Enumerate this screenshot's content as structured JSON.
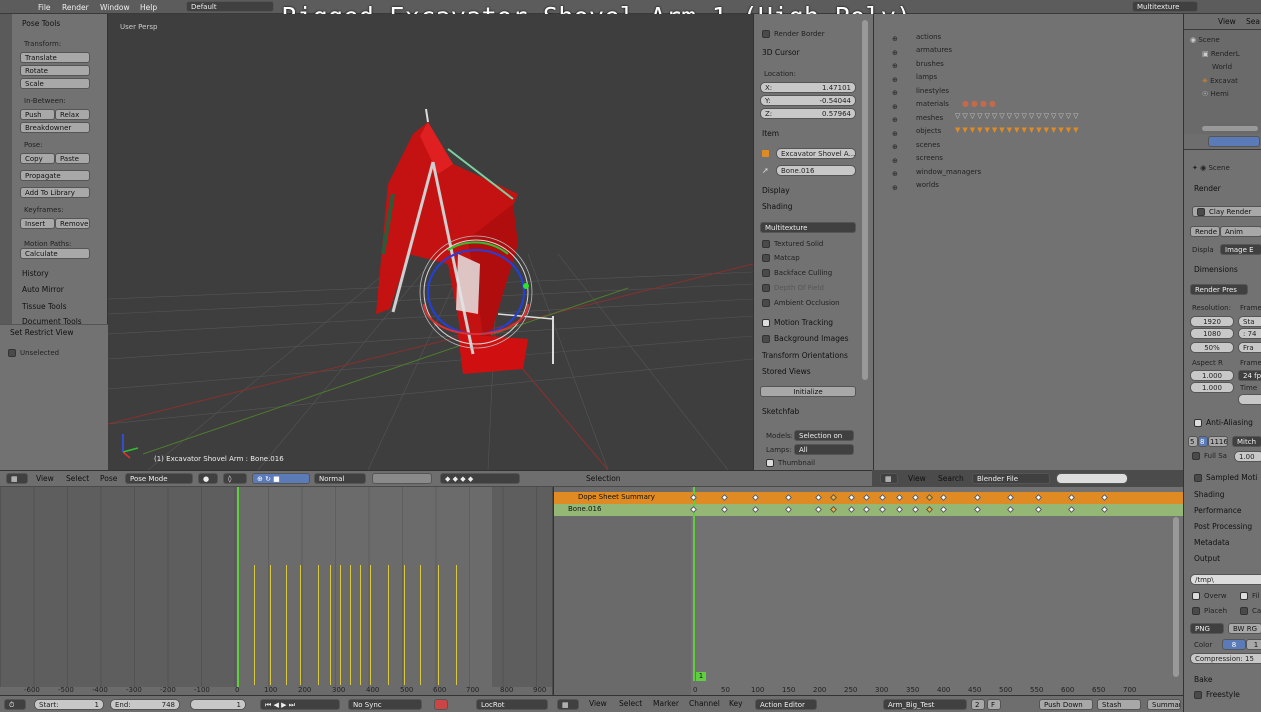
{
  "overlay_title": "Rigged Excavator Shovel Arm 1 (High Poly)",
  "top_menu": {
    "file": "File",
    "render": "Render",
    "window": "Window",
    "help": "Help",
    "layout": "Default",
    "engine_partial": "Multitexture"
  },
  "tool_shelf": {
    "header": "Pose Tools",
    "vertical_tabs": [
      "Tools",
      "Options",
      "Grease Pencil",
      "Display",
      "Animation",
      "Paper Model"
    ],
    "transform_label": "Transform:",
    "translate": "Translate",
    "rotate": "Rotate",
    "scale": "Scale",
    "inbetween_label": "In-Between:",
    "push": "Push",
    "relax": "Relax",
    "breakdowner": "Breakdowner",
    "pose_label": "Pose:",
    "copy": "Copy",
    "paste": "Paste",
    "propagate": "Propagate",
    "add_to_library": "Add To Library",
    "keyframes_label": "Keyframes:",
    "insert": "Insert",
    "remove": "Remove",
    "motion_paths_label": "Motion Paths:",
    "calculate": "Calculate",
    "history": "History",
    "auto_mirror": "Auto Mirror",
    "tissue_tools": "Tissue Tools",
    "document_tools": "Document Tools",
    "restrict_header": "Set Restrict View",
    "unselected": "Unselected"
  },
  "viewport": {
    "view_name": "User Persp",
    "status": "(1) Excavator Shovel Arm : Bone.016"
  },
  "viewport_header": {
    "view": "View",
    "select": "Select",
    "pose": "Pose",
    "mode": "Pose Mode",
    "orientation": "Normal",
    "selection": "Selection"
  },
  "properties_panel": {
    "render_border": "Render Border",
    "cursor_header": "3D Cursor",
    "location_label": "Location:",
    "x_label": "X:",
    "x_val": "1.47101",
    "y_label": "Y:",
    "y_val": "-0.54044",
    "z_label": "Z:",
    "z_val": "0.57964",
    "item_header": "Item",
    "item_name": "Excavator Shovel A...",
    "bone_name": "Bone.016",
    "display": "Display",
    "shading": "Shading",
    "shading_mode": "Multitexture",
    "textured_solid": "Textured Solid",
    "matcap": "Matcap",
    "backface_culling": "Backface Culling",
    "depth_of_field": "Depth Of Field",
    "ambient_occlusion": "Ambient Occlusion",
    "motion_tracking": "Motion Tracking",
    "background_images": "Background Images",
    "transform_orientations": "Transform Orientations",
    "stored_views": "Stored Views",
    "initialize": "Initialize",
    "sketchfab": "Sketchfab",
    "models_label": "Models:",
    "models_val": "Selection on",
    "lamps_label": "Lamps:",
    "lamps_val": "All",
    "thumbnail": "Thumbnail"
  },
  "datablocks": {
    "items": [
      "actions",
      "armatures",
      "brushes",
      "lamps",
      "linestyles",
      "materials",
      "meshes",
      "objects",
      "scenes",
      "screens",
      "window_managers",
      "worlds"
    ],
    "header_view": "View",
    "header_search": "Search",
    "mode": "Blender File"
  },
  "outliner": {
    "header_view": "View",
    "header_search": "Sea",
    "items": [
      "Scene",
      "RenderL",
      "World",
      "Excavat",
      "Hemi"
    ]
  },
  "render_props": {
    "scene": "Scene",
    "render": "Render",
    "clay_render": "Clay Render",
    "render_partial": "Rende",
    "anim_partial": "Anim",
    "display_label": "Displa",
    "display_val": "Image E",
    "dimensions": "Dimensions",
    "render_presets": "Render Pres",
    "resolution_label": "Resolution:",
    "res_x": "1920",
    "res_y": "1080",
    "res_pct": "50%",
    "frame_label": "Frame",
    "frame_start": "Sta",
    "frame_end": ": 74",
    "frame_step": "Fra",
    "aspect_label": "Aspect R",
    "aspect_x": "1.000",
    "aspect_y": "1.000",
    "frame_rate_label": "Frame",
    "fps": "24 fps",
    "time_label": "Time",
    "anti_aliasing": "Anti-Aliasing",
    "aa_8": "8",
    "aa_5": "5",
    "aa_11": "11",
    "aa_16": "16",
    "filter": "Mitch",
    "full_sample": "Full Sa",
    "full_sample_val": "1.00",
    "sampled_motion": "Sampled Moti",
    "shading": "Shading",
    "performance": "Performance",
    "post_processing": "Post Processing",
    "metadata": "Metadata",
    "output": "Output",
    "output_path": "/tmp\\",
    "overwrite": "Overw",
    "file_ext": "Fil",
    "placeholders": "Placeh",
    "cache": "Ca",
    "format": "PNG",
    "color_mode": "BW RG",
    "color_label": "Color",
    "color_depth": "8",
    "color_depth2": "1",
    "compression": "Compression: 15",
    "bake": "Bake",
    "freestyle": "Freestyle"
  },
  "graph_editor": {
    "ticks": [
      "-600",
      "-500",
      "-400",
      "-300",
      "-200",
      "-100",
      "0",
      "100",
      "200",
      "300",
      "400",
      "500",
      "600",
      "700",
      "800",
      "900"
    ]
  },
  "dopesheet": {
    "summary": "Dope Sheet Summary",
    "channel": "Bone.016",
    "current_frame": "1",
    "ticks": [
      "0",
      "50",
      "100",
      "150",
      "200",
      "250",
      "300",
      "350",
      "400",
      "450",
      "500",
      "550",
      "600",
      "650",
      "700"
    ]
  },
  "timeline_footer": {
    "start_label": "Start:",
    "start": "1",
    "end_label": "End:",
    "end": "748",
    "frame": "1",
    "sync": "No Sync",
    "keying": "LocRot"
  },
  "dopesheet_footer": {
    "view": "View",
    "select": "Select",
    "marker": "Marker",
    "channel": "Channel",
    "key": "Key",
    "editor": "Action Editor",
    "action": "Arm_Big_Test",
    "frames": "2",
    "f": "F",
    "push_down": "Push Down",
    "stash": "Stash",
    "summary": "Summar"
  },
  "colors": {
    "accent_orange": "#e08a24",
    "selection_green": "#5fcf3f",
    "mesh_red": "#d01010",
    "key_yellow": "#d8c840"
  }
}
